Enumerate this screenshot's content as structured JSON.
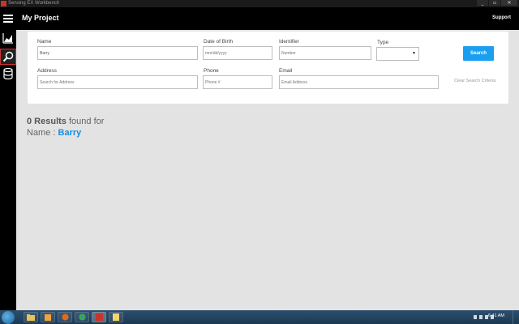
{
  "window": {
    "title": "Sensing EX Workbench",
    "buttons": [
      "_",
      "▫",
      "✕"
    ]
  },
  "header": {
    "title": "My Project",
    "support_label": "Support"
  },
  "sidebar": {
    "items": [
      {
        "icon": "chart-icon",
        "active": false
      },
      {
        "icon": "search-icon",
        "active": true
      },
      {
        "icon": "database-icon",
        "active": false
      }
    ]
  },
  "search": {
    "name_label": "Name",
    "name_value": "Barry",
    "dob_label": "Date of Birth",
    "dob_placeholder": "mm/dd/yyyy",
    "identifier_label": "Identifier",
    "identifier_placeholder": "Number",
    "type_label": "Type",
    "type_value": "",
    "search_button": "Search",
    "address_label": "Address",
    "address_placeholder": "Search for Address",
    "phone_label": "Phone",
    "phone_placeholder": "Phone #",
    "email_label": "Email",
    "email_placeholder": "Email Address",
    "clear_label": "Clear Search Criteria"
  },
  "results": {
    "count_text": "0 Results",
    "found_for": "found for",
    "field_label": "Name :",
    "field_value": "Barry"
  },
  "taskbar": {
    "clock": "6:41 AM"
  },
  "colors": {
    "accent": "#1a9ff0",
    "header_bg": "#000000",
    "page_bg": "#e3e3e3"
  }
}
